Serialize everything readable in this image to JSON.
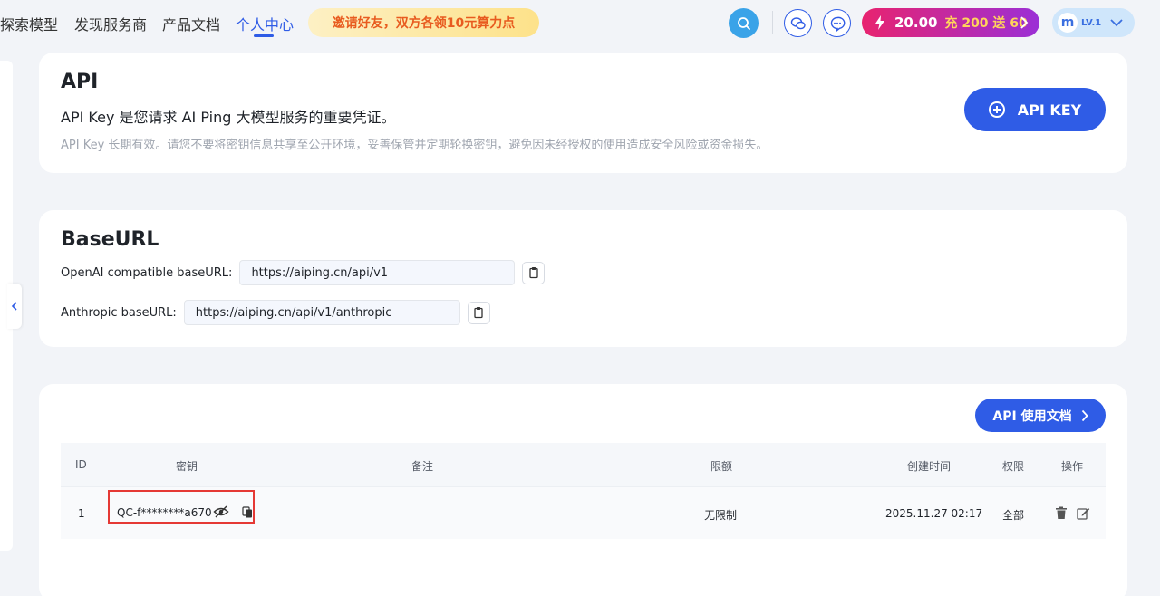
{
  "nav": {
    "items": [
      "探索模型",
      "发现服务商",
      "产品文档",
      "个人中心"
    ],
    "invite": "邀请好友，双方各领10元算力点",
    "recharge": {
      "balance": "20.00",
      "promo": "充 200 送 60"
    },
    "user": {
      "avatar_letter": "m",
      "level": "LV.1"
    },
    "icons": [
      "search-icon",
      "wechat-icon",
      "chat-icon",
      "lightning-icon",
      "chevron-right-icon",
      "chevron-down-icon"
    ]
  },
  "api_card": {
    "title": "API",
    "subtitle": "API Key 是您请求 AI Ping 大模型服务的重要凭证。",
    "note": "API Key 长期有效。请您不要将密钥信息共享至公开环境，妥善保管并定期轮换密钥，避免因未经授权的使用造成安全风险或资金损失。",
    "button": "API KEY"
  },
  "base_card": {
    "title": "BaseURL",
    "rows": [
      {
        "label": "OpenAI compatible baseURL:",
        "value": "https://aiping.cn/api/v1"
      },
      {
        "label": "Anthropic baseURL:",
        "value": "https://aiping.cn/api/v1/anthropic"
      }
    ]
  },
  "keys_card": {
    "docs_button": "API 使用文档",
    "columns": [
      "ID",
      "密钥",
      "备注",
      "限额",
      "创建时间",
      "权限",
      "操作"
    ],
    "rows": [
      {
        "id": "1",
        "key": "QC-f********a670",
        "note": "",
        "limit": "无限制",
        "created": "2025.11.27 02:17",
        "scope": "全部"
      }
    ]
  },
  "colors": {
    "primary": "#2f5ce6",
    "highlight": "#e53935",
    "invite_text": "#e85b1f"
  }
}
